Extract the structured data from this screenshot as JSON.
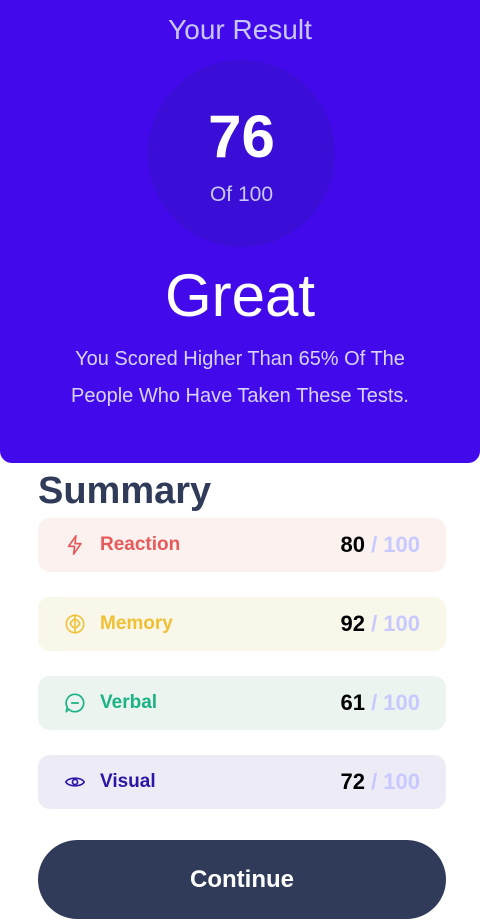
{
  "result": {
    "heading": "Your Result",
    "score": "76",
    "score_total": "Of 100",
    "rating": "Great",
    "description": "You Scored Higher Than 65% Of The People Who Have Taken These Tests."
  },
  "summary": {
    "title": "Summary",
    "items": [
      {
        "label": "Reaction",
        "score": "80",
        "max": " / 100",
        "icon": "lightning-icon",
        "color": "#e85a5a",
        "bg": "#fbf2f0"
      },
      {
        "label": "Memory",
        "score": "92",
        "max": " / 100",
        "icon": "brain-icon",
        "color": "#f0c033",
        "bg": "#f8f7ea"
      },
      {
        "label": "Verbal",
        "score": "61",
        "max": " / 100",
        "icon": "chat-bubble-icon",
        "color": "#1bb385",
        "bg": "#ebf4ef"
      },
      {
        "label": "Visual",
        "score": "72",
        "max": " / 100",
        "icon": "eye-icon",
        "color": "#2b16a6",
        "bg": "#edebf6"
      }
    ]
  },
  "actions": {
    "continue_label": "Continue"
  },
  "colors": {
    "accent": "#4209eb",
    "circle": "#3a0ed6",
    "dark": "#303b5a"
  }
}
